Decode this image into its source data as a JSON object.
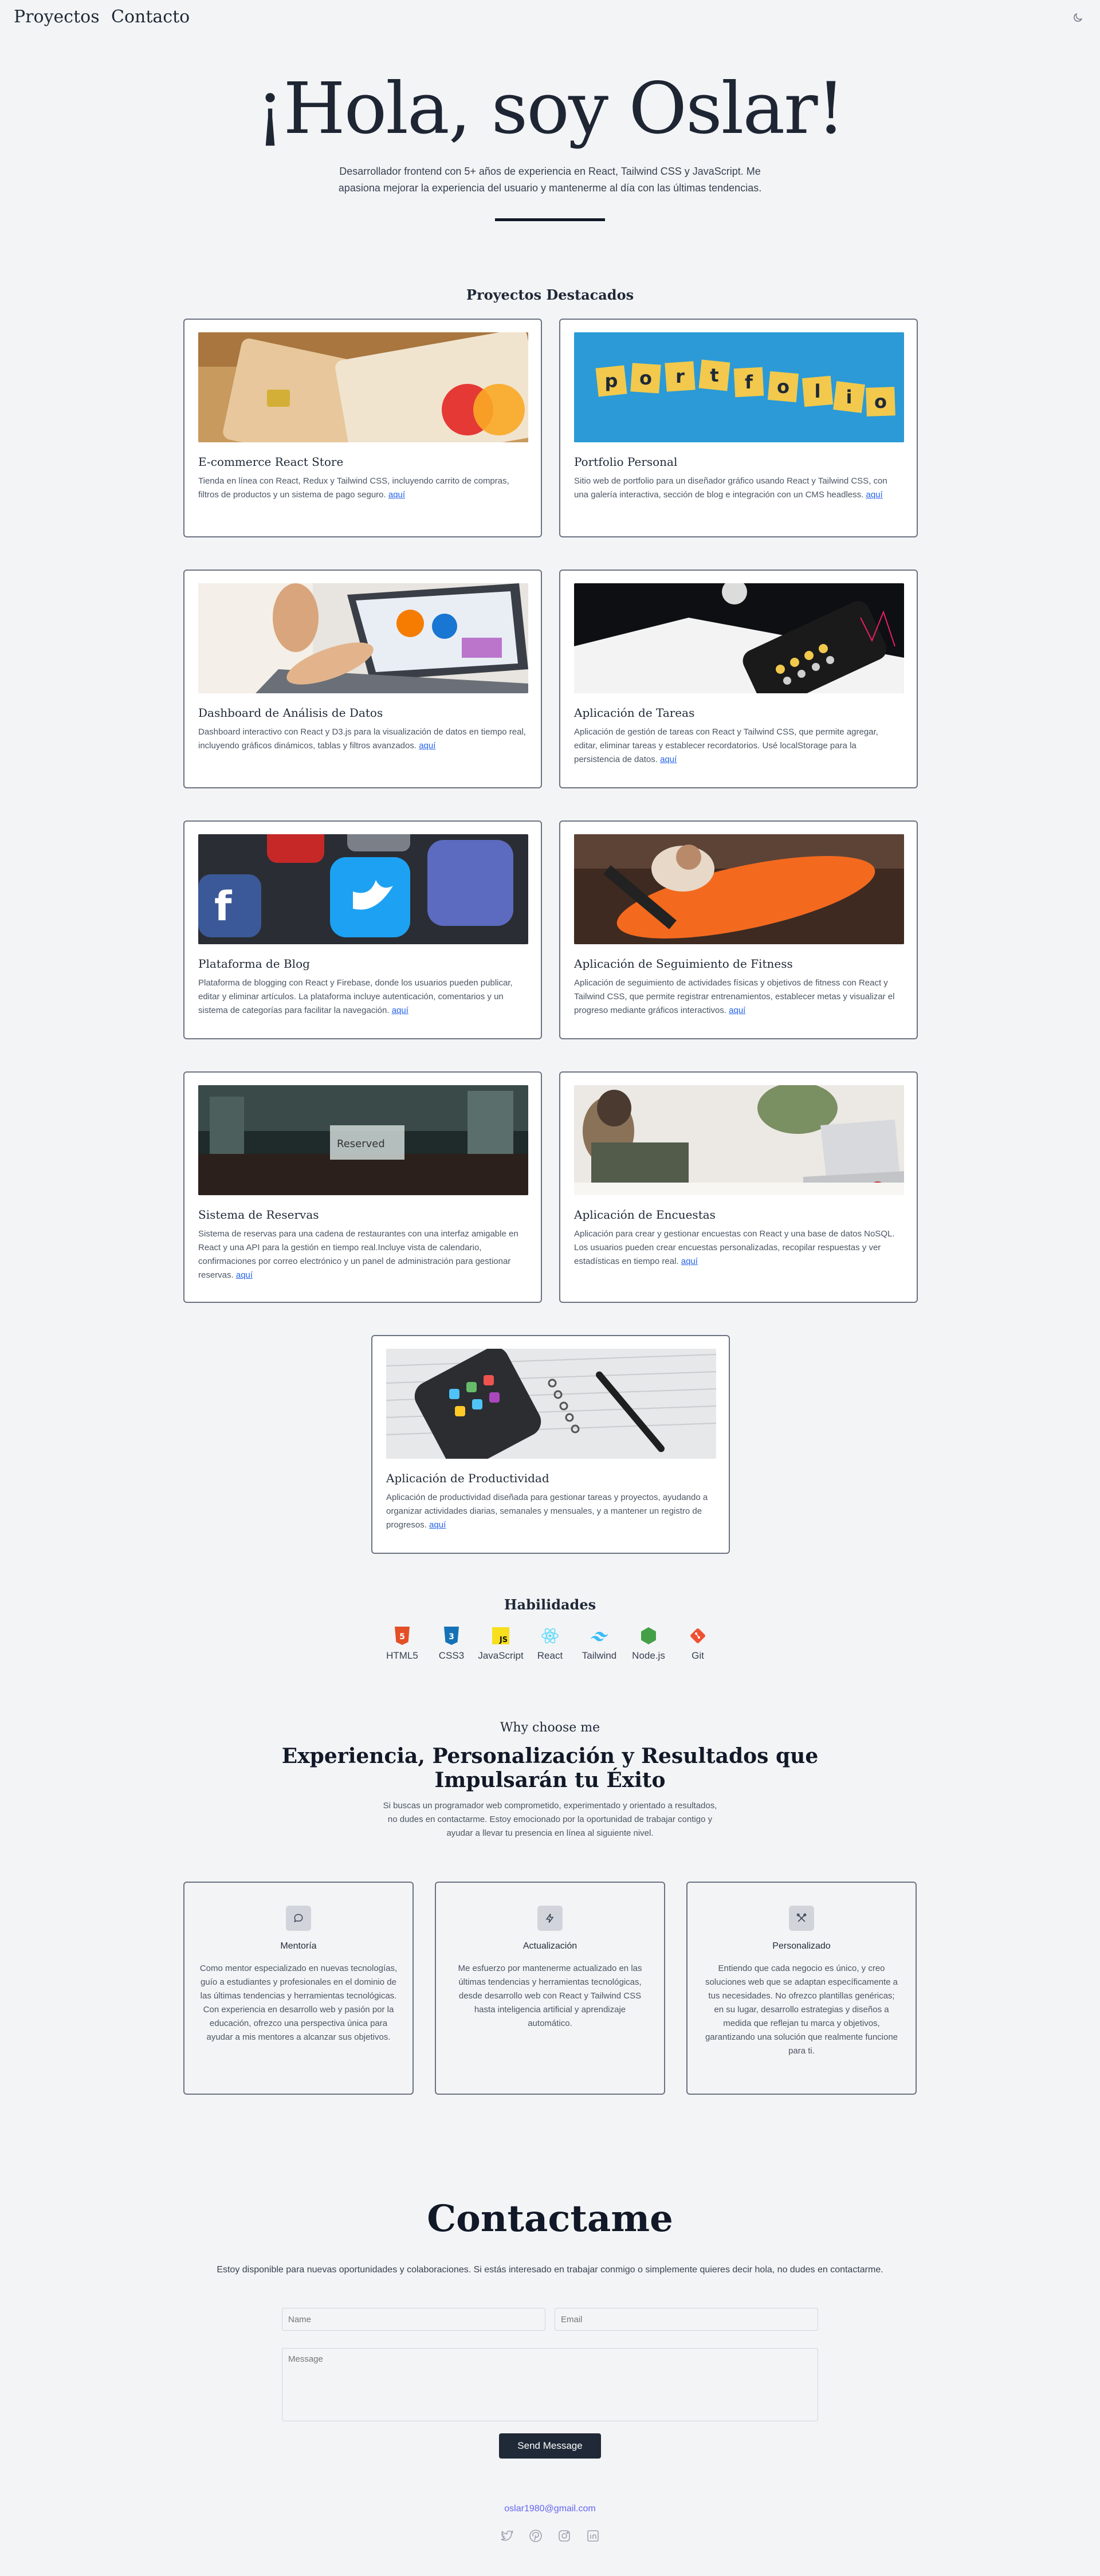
{
  "nav": {
    "projects": "Proyectos",
    "contact": "Contacto"
  },
  "hero": {
    "title": "¡Hola, soy Oslar!",
    "subtitle": "Desarrollador frontend con 5+ años de experiencia en React, Tailwind CSS y JavaScript. Me apasiona mejorar la experiencia del usuario y mantenerme al día con las últimas tendencias."
  },
  "projects": {
    "heading": "Proyectos Destacados",
    "link_text": "aquí",
    "items": [
      {
        "title": "E-commerce React Store",
        "desc": "Tienda en línea con React, Redux y Tailwind CSS, incluyendo carrito de compras, filtros de productos y un sistema de pago seguro."
      },
      {
        "title": "Portfolio Personal",
        "desc": "Sitio web de portfolio para un diseñador gráfico usando React y Tailwind CSS, con una galería interactiva, sección de blog e integración con un CMS headless."
      },
      {
        "title": "Dashboard de Análisis de Datos",
        "desc": "Dashboard interactivo con React y D3.js para la visualización de datos en tiempo real, incluyendo gráficos dinámicos, tablas y filtros avanzados."
      },
      {
        "title": "Aplicación de Tareas",
        "desc": "Aplicación de gestión de tareas con React y Tailwind CSS, que permite agregar, editar, eliminar tareas y establecer recordatorios. Usé localStorage para la persistencia de datos."
      },
      {
        "title": "Plataforma de Blog",
        "desc": "Plataforma de blogging con React y Firebase, donde los usuarios pueden publicar, editar y eliminar artículos. La plataforma incluye autenticación, comentarios y un sistema de categorías para facilitar la navegación."
      },
      {
        "title": "Aplicación de Seguimiento de Fitness",
        "desc": "Aplicación de seguimiento de actividades físicas y objetivos de fitness con React y Tailwind CSS, que permite registrar entrenamientos, establecer metas y visualizar el progreso mediante gráficos interactivos."
      },
      {
        "title": "Sistema de Reservas",
        "desc": "Sistema de reservas para una cadena de restaurantes con una interfaz amigable en React y una API para la gestión en tiempo real.Incluye vista de calendario, confirmaciones por correo electrónico y un panel de administración para gestionar reservas."
      },
      {
        "title": "Aplicación de Encuestas",
        "desc": "Aplicación para crear y gestionar encuestas con React y una base de datos NoSQL. Los usuarios pueden crear encuestas personalizadas, recopilar respuestas y ver estadísticas en tiempo real."
      },
      {
        "title": "Aplicación de Productividad",
        "desc": "Aplicación de productividad diseñada para gestionar tareas y proyectos, ayudando a organizar actividades diarias, semanales y mensuales, y a mantener un registro de progresos."
      }
    ]
  },
  "skills": {
    "heading": "Habilidades",
    "items": [
      {
        "label": "HTML5",
        "icon": "html5-icon",
        "color": "#e34f26"
      },
      {
        "label": "CSS3",
        "icon": "css3-icon",
        "color": "#1572b6"
      },
      {
        "label": "JavaScript",
        "icon": "javascript-icon",
        "color": "#f7df1e"
      },
      {
        "label": "React",
        "icon": "react-icon",
        "color": "#61dafb"
      },
      {
        "label": "Tailwind",
        "icon": "tailwind-icon",
        "color": "#38bdf8"
      },
      {
        "label": "Node.js",
        "icon": "nodejs-icon",
        "color": "#43a047"
      },
      {
        "label": "Git",
        "icon": "git-icon",
        "color": "#f05032"
      }
    ]
  },
  "why": {
    "kicker": "Why choose me",
    "title": "Experiencia, Personalización y Resultados que Impulsarán tu Éxito",
    "subtitle": "Si buscas un programador web comprometido, experimentado y orientado a resultados, no dudes en contactarme. Estoy emocionado por la oportunidad de trabajar contigo y ayudar a llevar tu presencia en línea al siguiente nivel.",
    "features": [
      {
        "title": "Mentoría",
        "icon": "chat-bubble-icon",
        "desc": "Como mentor especializado en nuevas tecnologías, guío a estudiantes y profesionales en el dominio de las últimas tendencias y herramientas tecnológicas. Con experiencia en desarrollo web y pasión por la educación, ofrezco una perspectiva única para ayudar a mis mentores a alcanzar sus objetivos."
      },
      {
        "title": "Actualización",
        "icon": "lightning-icon",
        "desc": "Me esfuerzo por mantenerme actualizado en las últimas tendencias y herramientas tecnológicas, desde desarrollo web con React y Tailwind CSS hasta inteligencia artificial y aprendizaje automático."
      },
      {
        "title": "Personalizado",
        "icon": "tools-icon",
        "desc": "Entiendo que cada negocio es único, y creo soluciones web que se adaptan específicamente a tus necesidades. No ofrezco plantillas genéricas; en su lugar, desarrollo estrategias y diseños a medida que reflejan tu marca y objetivos, garantizando una solución que realmente funcione para ti."
      }
    ]
  },
  "contact": {
    "title": "Contactame",
    "subtitle": "Estoy disponible para nuevas oportunidades y colaboraciones. Si estás interesado en trabajar conmigo o simplemente quieres decir hola, no dudes en contactarme.",
    "name_placeholder": "Name",
    "email_placeholder": "Email",
    "message_placeholder": "Message",
    "send_label": "Send Message",
    "email": "oslar1980@gmail.com"
  },
  "social_icons": [
    "twitter-icon",
    "pinterest-icon",
    "instagram-icon",
    "linkedin-icon"
  ]
}
